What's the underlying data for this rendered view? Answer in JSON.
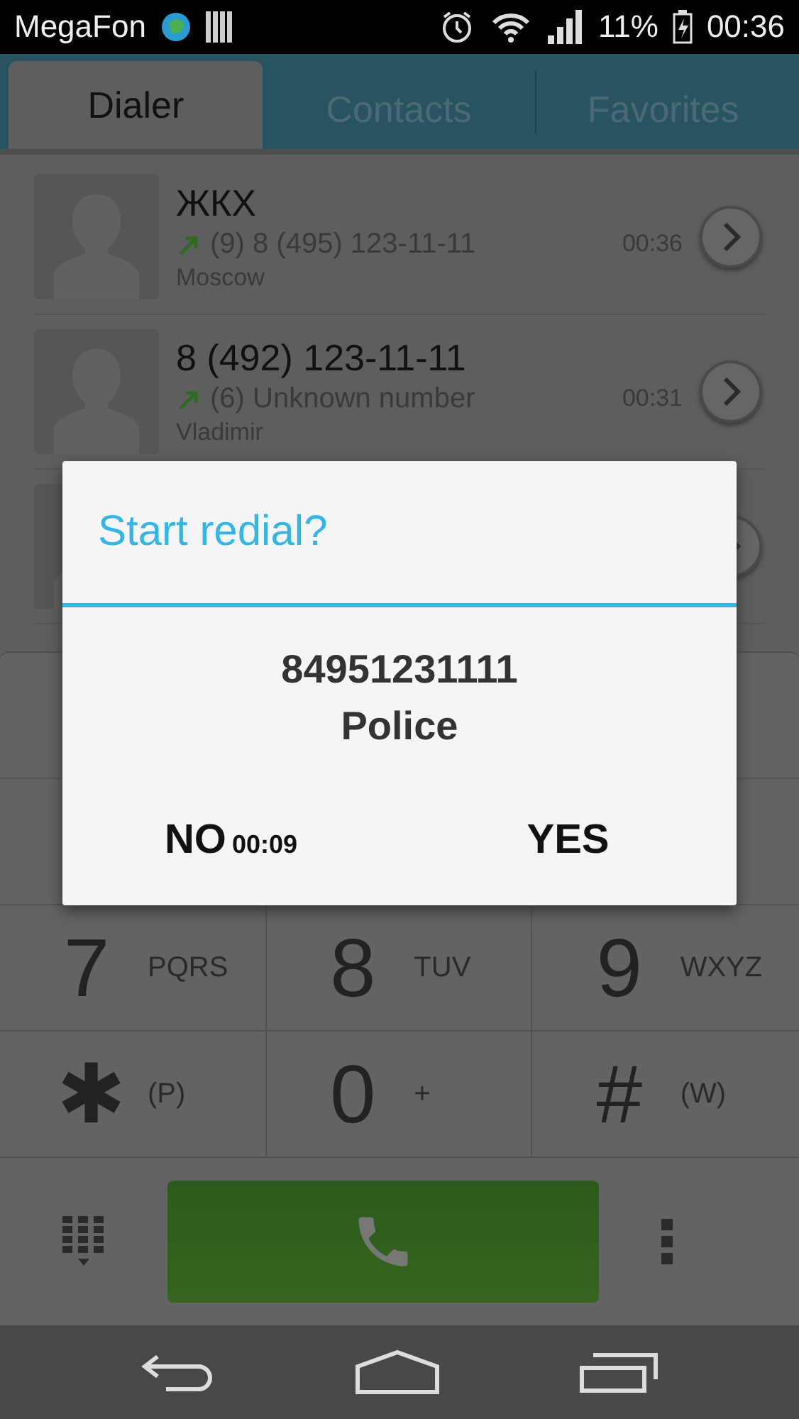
{
  "status_bar": {
    "carrier": "MegaFon",
    "battery": "11%",
    "time": "00:36"
  },
  "tabs": [
    {
      "label": "Dialer",
      "selected": true
    },
    {
      "label": "Contacts",
      "selected": false
    },
    {
      "label": "Favorites",
      "selected": false
    }
  ],
  "calls": [
    {
      "title": "ЖКХ",
      "detail": "(9) 8 (495) 123-11-11",
      "location": "Moscow",
      "time": "00:36"
    },
    {
      "title": "8 (492) 123-11-11",
      "detail": "(6) Unknown number",
      "location": "Vladimir",
      "time": "00:31"
    }
  ],
  "keypad": [
    {
      "digit": "7",
      "letters": "PQRS"
    },
    {
      "digit": "8",
      "letters": "TUV"
    },
    {
      "digit": "9",
      "letters": "WXYZ"
    },
    {
      "digit": "✱",
      "letters": "(P)"
    },
    {
      "digit": "0",
      "letters": "+"
    },
    {
      "digit": "#",
      "letters": "(W)"
    }
  ],
  "dialog": {
    "title": "Start redial?",
    "number": "84951231111",
    "name": "Police",
    "no": {
      "label": "NO",
      "countdown": "00:09"
    },
    "yes": {
      "label": "YES"
    }
  }
}
